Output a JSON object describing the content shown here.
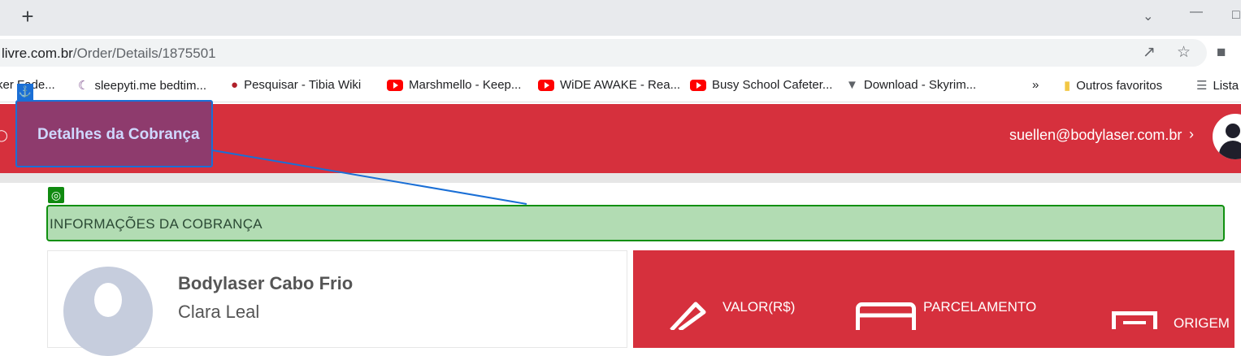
{
  "browser": {
    "url_domain": "livre.com.br",
    "url_path": "/Order/Details/1875501",
    "bookmarks": [
      "ker Fade...",
      "sleepyti.me bedtim...",
      "Pesquisar - Tibia Wiki",
      "Marshmello - Keep...",
      "WiDE AWAKE - Rea...",
      "Busy School Cafeter...",
      "Download - Skyrim...",
      "»",
      "Outros favoritos",
      "Lista"
    ]
  },
  "header": {
    "title": "Detalhes da Cobrança",
    "user_email": "suellen@bodylaser.com.br"
  },
  "section": {
    "title": "INFORMAÇÕES DA COBRANÇA"
  },
  "profile": {
    "company": "Bodylaser Cabo Frio",
    "name": "Clara Leal"
  },
  "stats": {
    "valor_label": "VALOR(R$)",
    "parcelamento_label": "PARCELAMENTO",
    "origem_label": "ORIGEM"
  },
  "colors": {
    "brand_red": "#d6303d",
    "highlight_green": "#b2dcb3",
    "selection_blue": "#1a6fd6"
  }
}
